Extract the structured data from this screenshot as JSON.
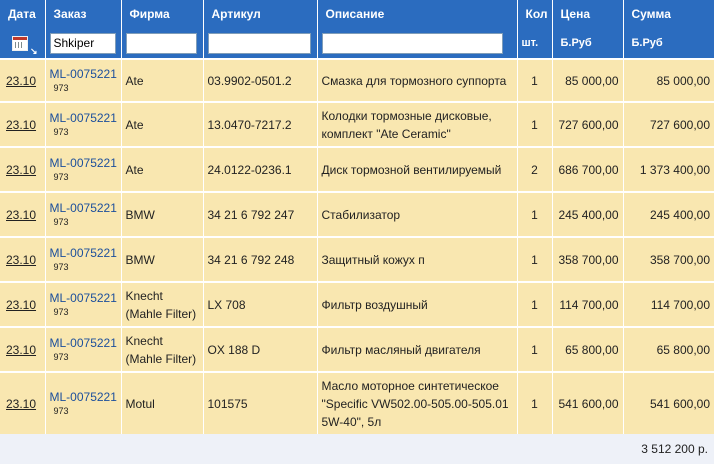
{
  "headers": {
    "date": "Дата",
    "order": "Заказ",
    "firm": "Фирма",
    "article": "Артикул",
    "description": "Описание",
    "qty": "Кол",
    "price": "Цена",
    "sum": "Сумма"
  },
  "subheaders": {
    "qty": "шт.",
    "price": "Б.Руб",
    "sum": "Б.Руб"
  },
  "filters": {
    "order": "Shkiper",
    "firm": "",
    "article": "",
    "description": ""
  },
  "rows": [
    {
      "date": "23.10",
      "order": "ML-0075221",
      "order_sub": "973",
      "firm": "Ate",
      "article": "03.9902-0501.2",
      "description": "Смазка для тормозного суппорта",
      "qty": "1",
      "price": "85 000,00",
      "sum": "85 000,00"
    },
    {
      "date": "23.10",
      "order": "ML-0075221",
      "order_sub": "973",
      "firm": "Ate",
      "article": "13.0470-7217.2",
      "description": "Колодки тормозные дисковые, комплект \"Ate Ceramic\"",
      "qty": "1",
      "price": "727 600,00",
      "sum": "727 600,00"
    },
    {
      "date": "23.10",
      "order": "ML-0075221",
      "order_sub": "973",
      "firm": "Ate",
      "article": "24.0122-0236.1",
      "description": "Диск тормозной вентилируемый",
      "qty": "2",
      "price": "686 700,00",
      "sum": "1 373 400,00"
    },
    {
      "date": "23.10",
      "order": "ML-0075221",
      "order_sub": "973",
      "firm": "BMW",
      "article": "34 21 6 792 247",
      "description": "Стабилизатор",
      "qty": "1",
      "price": "245 400,00",
      "sum": "245 400,00"
    },
    {
      "date": "23.10",
      "order": "ML-0075221",
      "order_sub": "973",
      "firm": "BMW",
      "article": "34 21 6 792 248",
      "description": "Защитный кожух п",
      "qty": "1",
      "price": "358 700,00",
      "sum": "358 700,00"
    },
    {
      "date": "23.10",
      "order": "ML-0075221",
      "order_sub": "973",
      "firm": "Knecht (Mahle Filter)",
      "article": "LX 708",
      "description": "Фильтр воздушный",
      "qty": "1",
      "price": "114 700,00",
      "sum": "114 700,00"
    },
    {
      "date": "23.10",
      "order": "ML-0075221",
      "order_sub": "973",
      "firm": "Knecht (Mahle Filter)",
      "article": "OX 188 D",
      "description": "Фильтр масляный двигателя",
      "qty": "1",
      "price": "65 800,00",
      "sum": "65 800,00"
    },
    {
      "date": "23.10",
      "order": "ML-0075221",
      "order_sub": "973",
      "firm": "Motul",
      "article": "101575",
      "description": "Масло моторное синтетическое \"Specific VW502.00-505.00-505.01 5W-40\", 5л",
      "qty": "1",
      "price": "541 600,00",
      "sum": "541 600,00"
    }
  ],
  "total": "3 512 200 р.",
  "icons": {
    "calendar": "calendar-icon",
    "resize": "resize-corner-icon"
  }
}
